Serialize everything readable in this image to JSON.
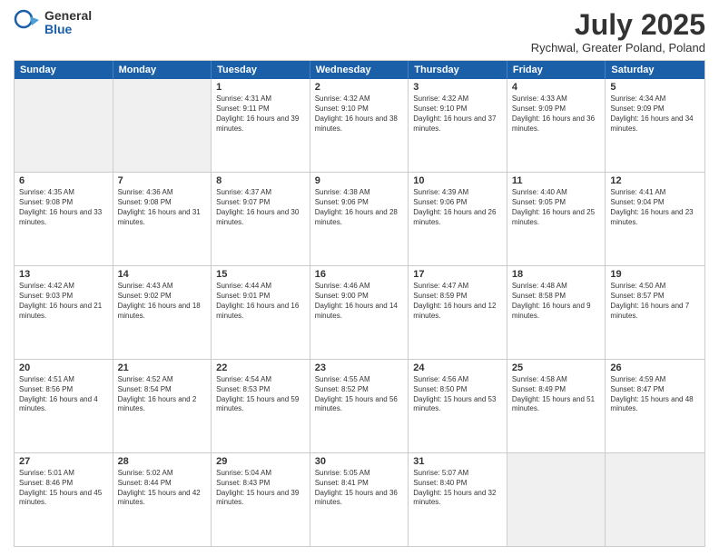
{
  "logo": {
    "general": "General",
    "blue": "Blue"
  },
  "title": "July 2025",
  "location": "Rychwal, Greater Poland, Poland",
  "header_days": [
    "Sunday",
    "Monday",
    "Tuesday",
    "Wednesday",
    "Thursday",
    "Friday",
    "Saturday"
  ],
  "weeks": [
    [
      {
        "day": "",
        "info": "",
        "shaded": true
      },
      {
        "day": "",
        "info": "",
        "shaded": true
      },
      {
        "day": "1",
        "info": "Sunrise: 4:31 AM\nSunset: 9:11 PM\nDaylight: 16 hours and 39 minutes."
      },
      {
        "day": "2",
        "info": "Sunrise: 4:32 AM\nSunset: 9:10 PM\nDaylight: 16 hours and 38 minutes."
      },
      {
        "day": "3",
        "info": "Sunrise: 4:32 AM\nSunset: 9:10 PM\nDaylight: 16 hours and 37 minutes."
      },
      {
        "day": "4",
        "info": "Sunrise: 4:33 AM\nSunset: 9:09 PM\nDaylight: 16 hours and 36 minutes."
      },
      {
        "day": "5",
        "info": "Sunrise: 4:34 AM\nSunset: 9:09 PM\nDaylight: 16 hours and 34 minutes."
      }
    ],
    [
      {
        "day": "6",
        "info": "Sunrise: 4:35 AM\nSunset: 9:08 PM\nDaylight: 16 hours and 33 minutes."
      },
      {
        "day": "7",
        "info": "Sunrise: 4:36 AM\nSunset: 9:08 PM\nDaylight: 16 hours and 31 minutes."
      },
      {
        "day": "8",
        "info": "Sunrise: 4:37 AM\nSunset: 9:07 PM\nDaylight: 16 hours and 30 minutes."
      },
      {
        "day": "9",
        "info": "Sunrise: 4:38 AM\nSunset: 9:06 PM\nDaylight: 16 hours and 28 minutes."
      },
      {
        "day": "10",
        "info": "Sunrise: 4:39 AM\nSunset: 9:06 PM\nDaylight: 16 hours and 26 minutes."
      },
      {
        "day": "11",
        "info": "Sunrise: 4:40 AM\nSunset: 9:05 PM\nDaylight: 16 hours and 25 minutes."
      },
      {
        "day": "12",
        "info": "Sunrise: 4:41 AM\nSunset: 9:04 PM\nDaylight: 16 hours and 23 minutes."
      }
    ],
    [
      {
        "day": "13",
        "info": "Sunrise: 4:42 AM\nSunset: 9:03 PM\nDaylight: 16 hours and 21 minutes."
      },
      {
        "day": "14",
        "info": "Sunrise: 4:43 AM\nSunset: 9:02 PM\nDaylight: 16 hours and 18 minutes."
      },
      {
        "day": "15",
        "info": "Sunrise: 4:44 AM\nSunset: 9:01 PM\nDaylight: 16 hours and 16 minutes."
      },
      {
        "day": "16",
        "info": "Sunrise: 4:46 AM\nSunset: 9:00 PM\nDaylight: 16 hours and 14 minutes."
      },
      {
        "day": "17",
        "info": "Sunrise: 4:47 AM\nSunset: 8:59 PM\nDaylight: 16 hours and 12 minutes."
      },
      {
        "day": "18",
        "info": "Sunrise: 4:48 AM\nSunset: 8:58 PM\nDaylight: 16 hours and 9 minutes."
      },
      {
        "day": "19",
        "info": "Sunrise: 4:50 AM\nSunset: 8:57 PM\nDaylight: 16 hours and 7 minutes."
      }
    ],
    [
      {
        "day": "20",
        "info": "Sunrise: 4:51 AM\nSunset: 8:56 PM\nDaylight: 16 hours and 4 minutes."
      },
      {
        "day": "21",
        "info": "Sunrise: 4:52 AM\nSunset: 8:54 PM\nDaylight: 16 hours and 2 minutes."
      },
      {
        "day": "22",
        "info": "Sunrise: 4:54 AM\nSunset: 8:53 PM\nDaylight: 15 hours and 59 minutes."
      },
      {
        "day": "23",
        "info": "Sunrise: 4:55 AM\nSunset: 8:52 PM\nDaylight: 15 hours and 56 minutes."
      },
      {
        "day": "24",
        "info": "Sunrise: 4:56 AM\nSunset: 8:50 PM\nDaylight: 15 hours and 53 minutes."
      },
      {
        "day": "25",
        "info": "Sunrise: 4:58 AM\nSunset: 8:49 PM\nDaylight: 15 hours and 51 minutes."
      },
      {
        "day": "26",
        "info": "Sunrise: 4:59 AM\nSunset: 8:47 PM\nDaylight: 15 hours and 48 minutes."
      }
    ],
    [
      {
        "day": "27",
        "info": "Sunrise: 5:01 AM\nSunset: 8:46 PM\nDaylight: 15 hours and 45 minutes."
      },
      {
        "day": "28",
        "info": "Sunrise: 5:02 AM\nSunset: 8:44 PM\nDaylight: 15 hours and 42 minutes."
      },
      {
        "day": "29",
        "info": "Sunrise: 5:04 AM\nSunset: 8:43 PM\nDaylight: 15 hours and 39 minutes."
      },
      {
        "day": "30",
        "info": "Sunrise: 5:05 AM\nSunset: 8:41 PM\nDaylight: 15 hours and 36 minutes."
      },
      {
        "day": "31",
        "info": "Sunrise: 5:07 AM\nSunset: 8:40 PM\nDaylight: 15 hours and 32 minutes."
      },
      {
        "day": "",
        "info": "",
        "shaded": true
      },
      {
        "day": "",
        "info": "",
        "shaded": true
      }
    ]
  ]
}
